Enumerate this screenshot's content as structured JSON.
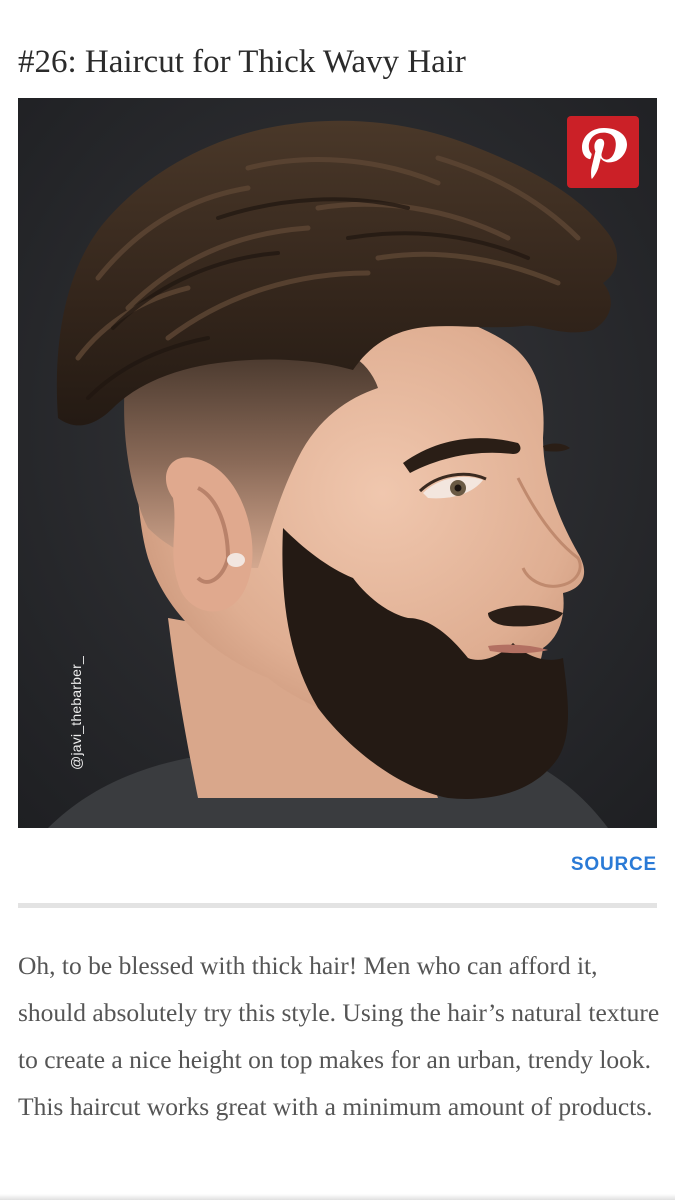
{
  "article": {
    "title": "#26: Haircut for Thick Wavy Hair",
    "photo": {
      "credit": "@javi_thebarber_",
      "pin_icon": "pinterest-icon",
      "colors": {
        "backdrop": "#26272a",
        "hair": "#3a2a1f",
        "skin": "#e3b9a0",
        "beard": "#231a15",
        "shirt": "#3a3c3f"
      }
    },
    "source_label": "SOURCE",
    "description": "Oh, to be blessed with thick hair! Men who can afford it, should absolutely try this style. Using the hair’s natural texture to create a nice height on top makes for an urban, trendy look. This haircut works great with a minimum amount of products."
  },
  "colors": {
    "pinterest_red": "#cb2027",
    "link_blue": "#2a7ad6",
    "divider": "#e3e3e3",
    "body_text": "#555555",
    "title_text": "#2b2b2b"
  }
}
